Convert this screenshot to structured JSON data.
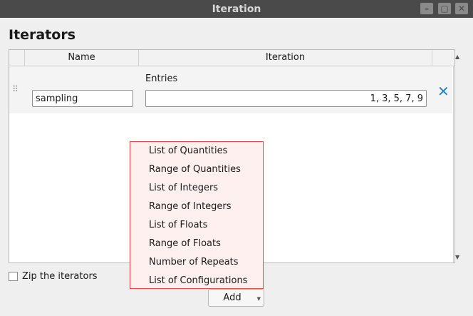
{
  "window": {
    "title": "Iteration"
  },
  "heading": "Iterators",
  "table": {
    "columns": [
      "Name",
      "Iteration"
    ],
    "rows": [
      {
        "name": "sampling",
        "type_label": "Entries",
        "entries": "1, 3, 5, 7, 9"
      }
    ]
  },
  "menu": {
    "items": [
      "List of Quantities",
      "Range of Quantities",
      "List of Integers",
      "Range of Integers",
      "List of Floats",
      "Range of Floats",
      "Number of Repeats",
      "List of Configurations"
    ]
  },
  "zip_label": "Zip the iterators",
  "add_label": "Add",
  "colors": {
    "accent": "#2d7fc6",
    "menu_border": "#e04a3f",
    "titlebar": "#4a4a4a"
  }
}
